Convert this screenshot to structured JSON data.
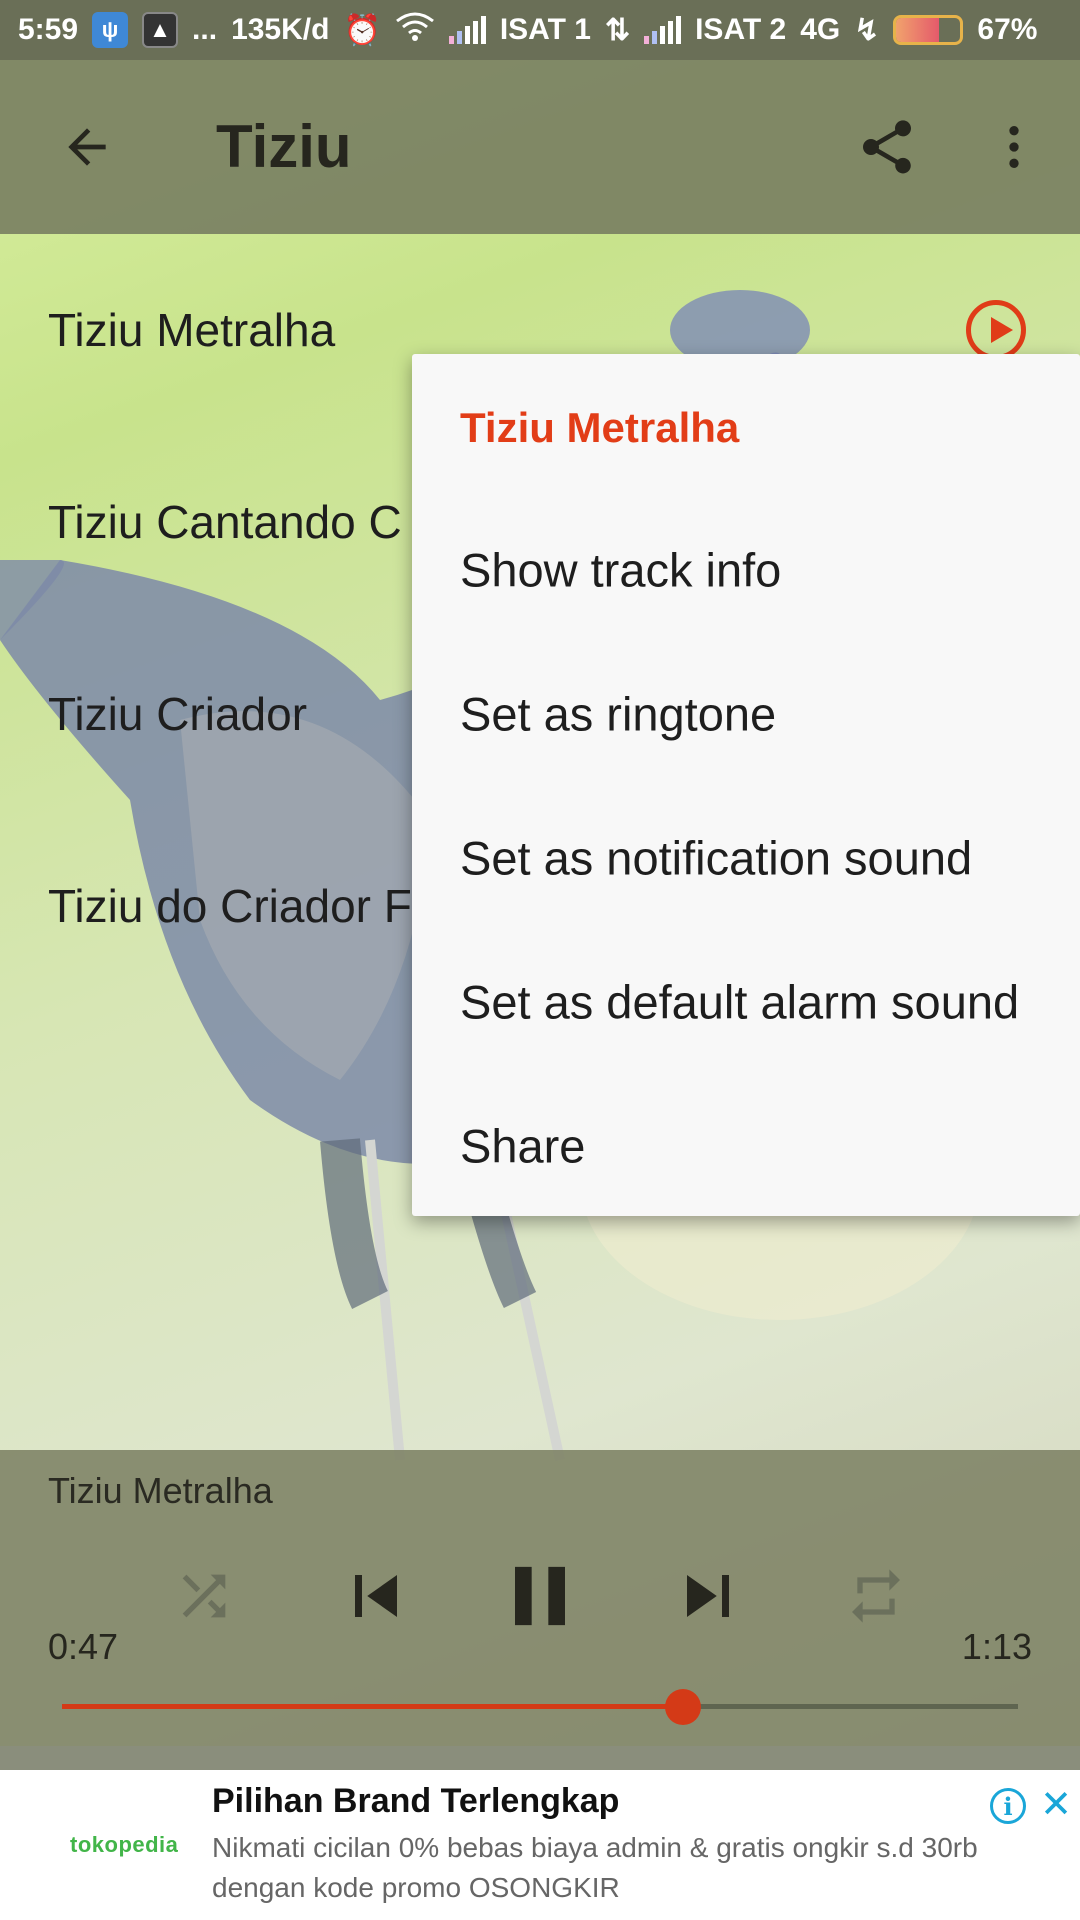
{
  "status_bar": {
    "time": "5:59",
    "dots": "...",
    "net_speed": "135K/d",
    "carrier1": "ISAT 1",
    "carrier2": "ISAT 2",
    "network_type": "4G",
    "battery_percent": "67%",
    "battery_level": 0.67,
    "icons": [
      "usb-icon",
      "app-icon",
      "alarm-icon",
      "wifi-icon",
      "signal-icon",
      "data-arrows-icon",
      "signal-icon",
      "charging-icon",
      "battery-icon"
    ]
  },
  "app_bar": {
    "title": "Tiziu",
    "back_icon": "arrow-left-icon",
    "share_icon": "share-icon",
    "more_icon": "more-vert-icon"
  },
  "tracks": [
    {
      "label": "Tiziu Metralha",
      "playing": true
    },
    {
      "label": "Tiziu Cantando C"
    },
    {
      "label": "Tiziu Criador"
    },
    {
      "label": "Tiziu do Criador F"
    }
  ],
  "context_menu": {
    "title": "Tiziu Metralha",
    "items": [
      "Show track info",
      "Set as ringtone",
      "Set as notification sound",
      "Set as default alarm sound",
      "Share"
    ]
  },
  "player": {
    "now_playing": "Tiziu Metralha",
    "elapsed": "0:47",
    "total": "1:13",
    "progress": 0.65,
    "controls": [
      "shuffle-icon",
      "skip-previous-icon",
      "pause-icon",
      "skip-next-icon",
      "repeat-icon"
    ]
  },
  "ad": {
    "logo": "tokopedia",
    "title": "Pilihan Brand Terlengkap",
    "body": "Nikmati cicilan 0% bebas biaya admin & gratis ongkir s.d 30rb dengan kode promo OSONGKIR",
    "info_icon": "info-icon",
    "close_icon": "close-icon"
  },
  "colors": {
    "accent": "#e23d17",
    "app_bar": "#7a8062",
    "player_bg": "#7d8264",
    "ad_info": "#1aa6d8"
  }
}
